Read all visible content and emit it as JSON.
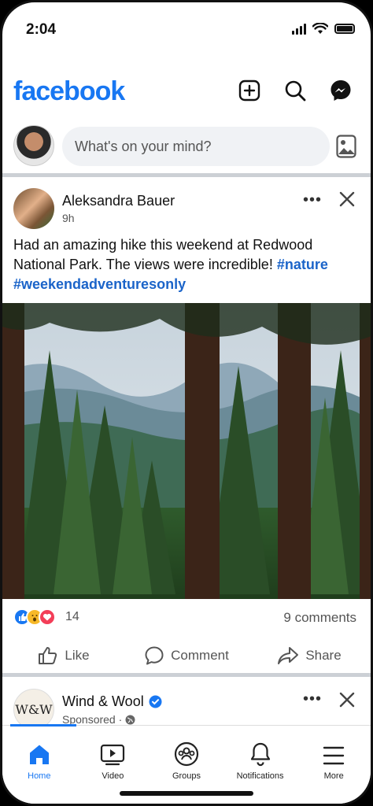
{
  "status": {
    "time": "2:04"
  },
  "header": {
    "logo": "facebook",
    "icons": [
      "add-icon",
      "search-icon",
      "messenger-icon"
    ]
  },
  "composer": {
    "placeholder": "What's on your mind?"
  },
  "post": {
    "author": "Aleksandra Bauer",
    "time": "9h",
    "text": "Had an amazing hike this weekend at Redwood National Park. The views were incredible! ",
    "tag1": "#nature",
    "tag2": "#weekendadventuresonly",
    "reaction_count": "14",
    "comments": "9 comments",
    "actions": {
      "like": "Like",
      "comment": "Comment",
      "share": "Share"
    }
  },
  "sponsored": {
    "logo_text": "W&W",
    "name": "Wind & Wool",
    "sub": "Sponsored ·"
  },
  "nav": {
    "items": [
      {
        "label": "Home"
      },
      {
        "label": "Video"
      },
      {
        "label": "Groups"
      },
      {
        "label": "Notifications"
      },
      {
        "label": "More"
      }
    ]
  },
  "colors": {
    "brand": "#1877f2",
    "hashtag": "#1b64c9"
  }
}
